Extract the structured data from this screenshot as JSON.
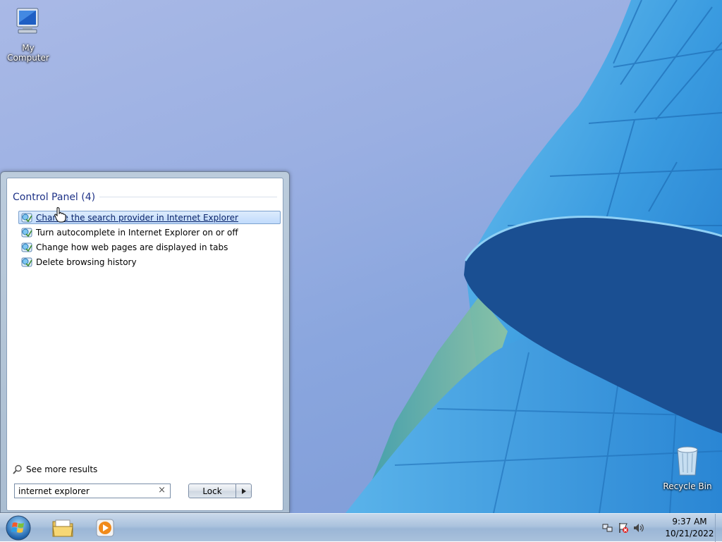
{
  "desktop": {
    "icons": [
      {
        "label": "My Computer",
        "icon": "computer-icon"
      },
      {
        "label": "Recycle Bin",
        "icon": "recycle-bin-icon"
      }
    ]
  },
  "start_menu": {
    "group_title": "Control Panel (4)",
    "results": [
      {
        "label": "Change the search provider in Internet Explorer",
        "icon": "control-panel-icon",
        "hovered": true
      },
      {
        "label": "Turn autocomplete in Internet Explorer on or off",
        "icon": "control-panel-icon"
      },
      {
        "label": "Change how web pages are displayed in tabs",
        "icon": "control-panel-icon"
      },
      {
        "label": "Delete browsing history",
        "icon": "control-panel-icon"
      }
    ],
    "see_more": "See more results",
    "search": {
      "value": "internet explorer",
      "clear_glyph": "×"
    },
    "lock_button": "Lock",
    "lock_arrow_icon": "arrow-right-icon"
  },
  "taskbar": {
    "pinned": [
      {
        "name": "windows-explorer",
        "icon": "folder-icon"
      },
      {
        "name": "media-player",
        "icon": "media-player-icon"
      }
    ],
    "tray_icons": [
      "network-icon",
      "action-center-flag-icon",
      "volume-icon"
    ],
    "clock": {
      "time": "9:37 AM",
      "date": "10/21/2022"
    }
  },
  "colors": {
    "link_hover": "#0a246a",
    "group_title": "#1e3287",
    "accent": "#1e90d8"
  }
}
